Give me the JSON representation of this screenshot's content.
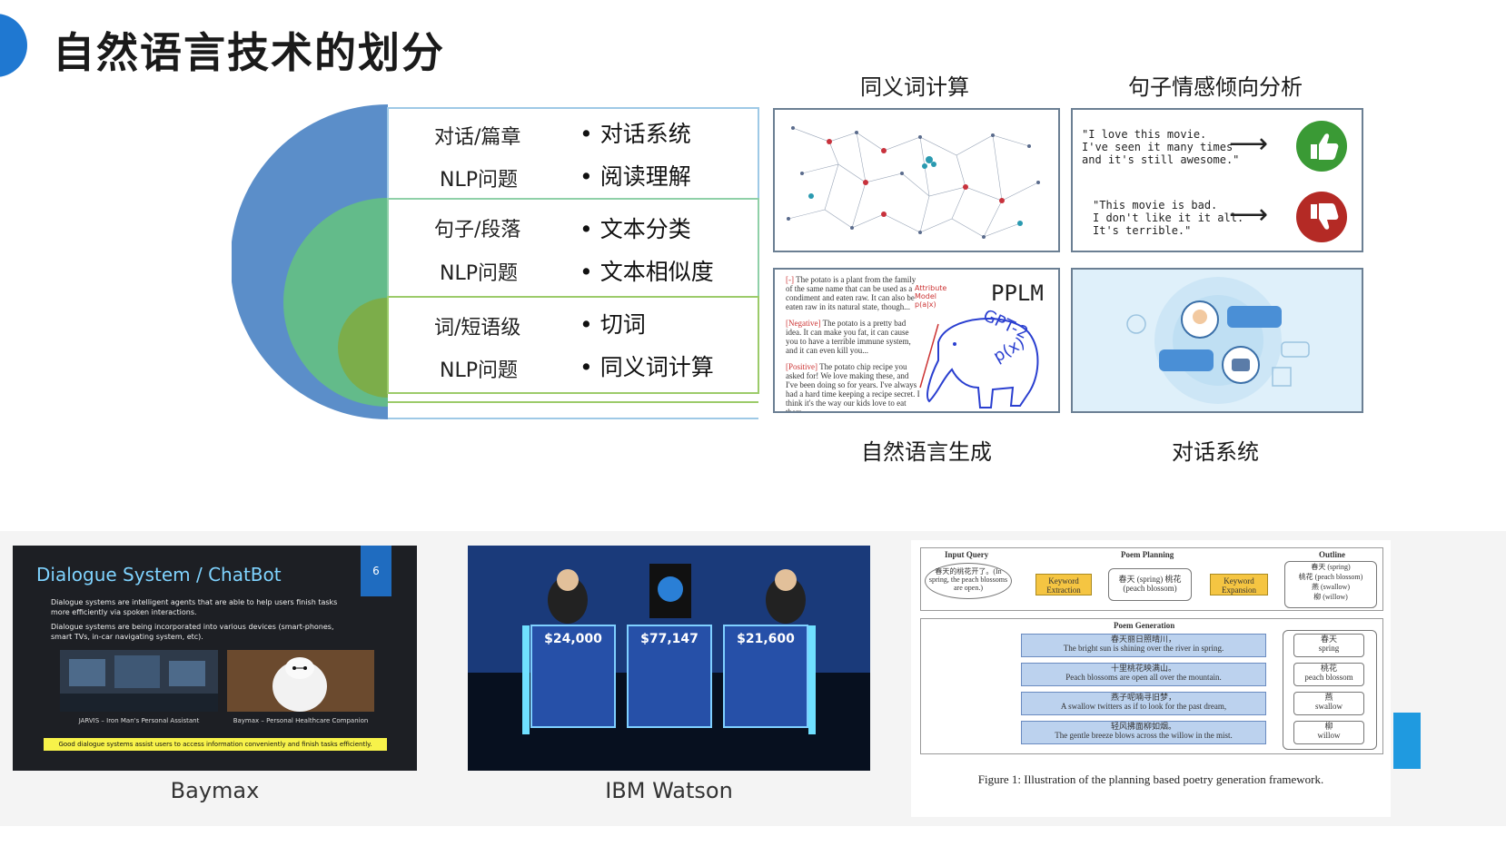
{
  "header": {
    "title": "自然语言技术的划分"
  },
  "hierarchy": {
    "levels": [
      {
        "level": "对话/篇章",
        "problem": "NLP问题",
        "items": [
          "对话系统",
          "阅读理解"
        ],
        "color": "#5b8ec9"
      },
      {
        "level": "句子/段落",
        "problem": "NLP问题",
        "items": [
          "文本分类",
          "文本相似度"
        ],
        "color": "#63bb8a"
      },
      {
        "level": "词/短语级",
        "problem": "NLP问题",
        "items": [
          "切词",
          "同义词计算"
        ],
        "color": "#7cad4a"
      }
    ]
  },
  "panels": {
    "synonym": {
      "caption": "同义词计算"
    },
    "sentiment": {
      "caption": "句子情感倾向分析",
      "positive_quote": [
        "\"I love this movie.",
        "I've seen it many times",
        "and it's still awesome.\""
      ],
      "negative_quote": [
        "\"This movie is bad.",
        "I don't like it it all.",
        "It's terrible.\""
      ],
      "arrow": "⟶"
    },
    "nlg": {
      "caption": "自然语言生成",
      "label": "PPLM",
      "model": "GPT-2",
      "formula": "p(x)",
      "attribute": "Attribute Model p(a|x)",
      "samples": [
        {
          "tag": "[-]",
          "text": "The potato is a plant from the family of the same name that can be used as a condiment and eaten raw. It can also be eaten raw in its natural state, though..."
        },
        {
          "tag": "[Negative]",
          "text": "The potato is a pretty bad idea. It can make you fat, it can cause you to have a terrible immune system, and it can even kill you..."
        },
        {
          "tag": "[Positive]",
          "text": "The potato chip recipe you asked for! We love making these, and I've been doing so for years. I've always had a hard time keeping a recipe secret. I think it's the way our kids love to eat them..."
        }
      ]
    },
    "dialogue": {
      "caption": "对话系统"
    }
  },
  "examples": {
    "baymax": {
      "caption": "Baymax",
      "slide_title": "Dialogue System / ChatBot",
      "slide_number": "6",
      "bullets": [
        "Dialogue systems are intelligent agents that are able to help users finish tasks more efficiently via spoken interactions.",
        "Dialogue systems are being incorporated into various devices (smart-phones, smart TVs, in-car navigating system, etc)."
      ],
      "image_captions": [
        "JARVIS – Iron Man's Personal Assistant",
        "Baymax – Personal Healthcare Companion"
      ],
      "footer": "Good dialogue systems assist users to access information conveniently and finish tasks efficiently."
    },
    "watson": {
      "caption": "IBM Watson",
      "scores": [
        "$24,000",
        "$77,147",
        "$21,600"
      ]
    },
    "poetry": {
      "input_query_title": "Input Query",
      "input_query": "春天的桃花开了。(In spring, the peach blossoms are open.)",
      "planning_title": "Poem Planning",
      "keyword_extraction": "Keyword Extraction",
      "keyword_expansion": "Keyword Expansion",
      "planning_mid": "春天 (spring) 桃花 (peach blossom)",
      "outline_title": "Outline",
      "outline": [
        "春天 (spring)",
        "桃花 (peach blossom)",
        "燕 (swallow)",
        "柳 (willow)"
      ],
      "generation_title": "Poem Generation",
      "lines": [
        {
          "zh": "春天丽日照晴川，",
          "en": "The bright sun is shining over the river in spring.",
          "kw": "春天",
          "kw_en": "spring"
        },
        {
          "zh": "十里桃花映满山。",
          "en": "Peach blossoms are open all over the mountain.",
          "kw": "桃花",
          "kw_en": "peach blossom"
        },
        {
          "zh": "燕子呢喃寻旧梦，",
          "en": "A swallow twitters as if to look for the past dream,",
          "kw": "燕",
          "kw_en": "swallow"
        },
        {
          "zh": "轻风拂面柳如烟。",
          "en": "The gentle breeze blows across the willow in the mist.",
          "kw": "柳",
          "kw_en": "willow"
        }
      ],
      "figure_caption": "Figure 1:  Illustration of the planning based poetry generation framework."
    }
  }
}
